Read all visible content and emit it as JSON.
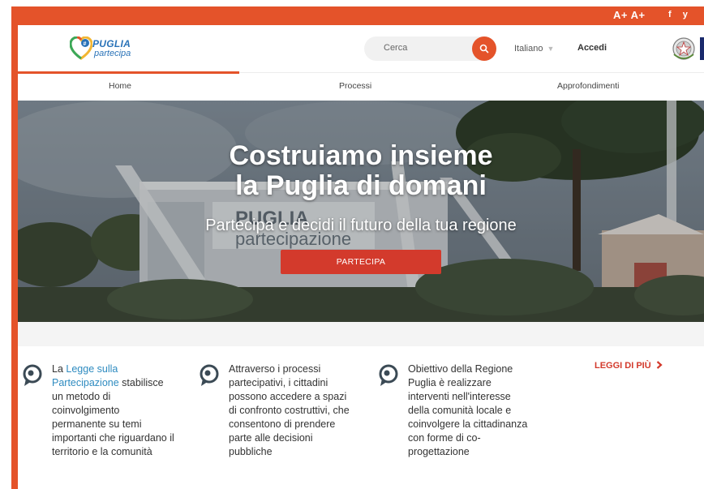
{
  "topbar": {
    "font_size_controls": "A+ A+",
    "social": [
      "f",
      "y"
    ]
  },
  "brand": {
    "logo_word1": "PUGLIA",
    "logo_word2": "partecipa"
  },
  "header": {
    "search_placeholder": "Cerca",
    "language": "Italiano",
    "login": "Accedi"
  },
  "nav": {
    "items": [
      "Home",
      "Processi",
      "Approfondimenti"
    ],
    "active": "Home"
  },
  "hero": {
    "title_line1": "Costruiamo insieme",
    "title_line2": "la Puglia di domani",
    "subtitle": "Partecipa e decidi il futuro della tua regione",
    "cta": "PARTECIPA",
    "sign_text1": "PUGLIA",
    "sign_text2": "partecipazione"
  },
  "features": [
    {
      "text_before": "La ",
      "link": "Legge sulla Partecipazione",
      "text_after": " stabilisce un metodo di coinvolgimento permanente su temi importanti che riguardano il territorio e la comunità"
    },
    {
      "text_before": "Attraverso i processi partecipativi, i cittadini possono accedere a spazi di confronto costruttivi, che consentono di prendere parte alle decisioni pubbliche",
      "link": "",
      "text_after": ""
    },
    {
      "text_before": "Obiettivo della Regione Puglia è realizzare interventi nell'interesse della comunità locale e coinvolgere la cittadinanza con forme di co-progettazione",
      "link": "",
      "text_after": ""
    }
  ],
  "read_more": "LEGGI DI PIÙ",
  "colors": {
    "accent": "#e4532a",
    "cta": "#d33a2c",
    "link": "#2e8bc0",
    "brand_blue": "#2a73b8"
  }
}
